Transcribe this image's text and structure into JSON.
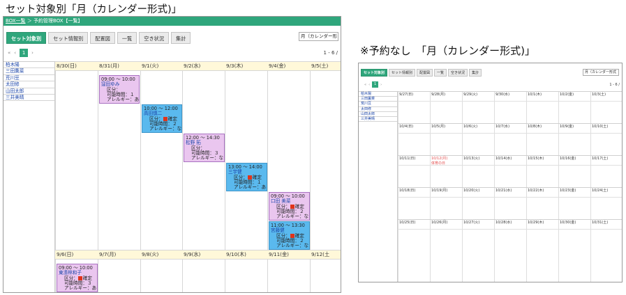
{
  "headings": {
    "main": "セット対象別「月（カレンダー形式)」",
    "no_reservation": "※予約なし　「月（カレンダー形式)」"
  },
  "panel1": {
    "topbar": {
      "crumb": "BOX一覧",
      "sep": " ＞ ",
      "title": "予約管理BOX【一覧】"
    },
    "tabs": [
      "セット対象別",
      "セット情報別",
      "配置図",
      "一覧",
      "空き状況",
      "集計"
    ],
    "view_select": "月（カレンダー形",
    "pager": {
      "first": "«",
      "prev": "‹",
      "current": "1",
      "next": "›"
    },
    "count": "1 - 6 /",
    "names": [
      "柏木陽",
      "三田薫菜",
      "荒川豆",
      "太田修",
      "山田太郎",
      "三井美晴"
    ],
    "week1": [
      "8/30(日)",
      "8/31(月)",
      "9/1(火)",
      "9/2(水)",
      "9/3(木)",
      "9/4(金)",
      "9/5(土)"
    ],
    "week2": [
      "9/6(日)",
      "9/7(月)",
      "9/8(火)",
      "9/9(水)",
      "9/10(木)",
      "9/11(金)",
      "9/12(土"
    ],
    "events": [
      {
        "time": "09:00 ～ 10:00",
        "name": "窪田ゆみ",
        "kubun": "区分：",
        "status": "",
        "kanou": "可能時間：１",
        "allergy": "アレルギー：あり",
        "color": "pink"
      },
      {
        "time": "10:00 ～ 12:00",
        "name": "高田慎二",
        "kubun": "区分：",
        "status": "確定",
        "kanou": "可能時間：２",
        "allergy": "アレルギー：なし",
        "color": "blue"
      },
      {
        "time": "12:00 ～ 14:30",
        "name": "松野 拓",
        "kubun": "区分：",
        "status": "",
        "kanou": "可能時間：３",
        "allergy": "アレルギー：なし",
        "color": "pink"
      },
      {
        "time": "13:00 ～ 14:00",
        "name": "三宇健",
        "kubun": "区分：",
        "status": "確定",
        "kanou": "可能時間：１",
        "allergy": "アレルギー：あり",
        "color": "blue"
      },
      {
        "time": "09:00 ～ 10:00",
        "name": "口田 美菜",
        "kubun": "区分：",
        "status": "確定",
        "kanou": "可能時間：２",
        "allergy": "アレルギー：なし",
        "color": "pink"
      },
      {
        "time": "11:00 ～ 13:30",
        "name": "宮藤健",
        "kubun": "区分：",
        "status": "確定",
        "kanou": "可能時間：２",
        "allergy": "アレルギー：なし",
        "color": "blue"
      },
      {
        "time": "09:00 ～ 10:00",
        "name": "東湊林和子",
        "kubun": "区分：",
        "status": "確定",
        "kanou": "可能時間：３",
        "allergy": "アレルギー：あり",
        "color": "pink"
      }
    ]
  },
  "panel2": {
    "tabs": [
      "セット対象別",
      "セット情報別",
      "配置図",
      "一覧",
      "空き状況",
      "集計"
    ],
    "view_select": "月（カレンダー形式",
    "pager": {
      "first": "«",
      "prev": "‹",
      "current": "1",
      "next": "›"
    },
    "count": "1 - 6 /",
    "names": [
      "柏木陽",
      "三田薫菜",
      "荒川豆",
      "太田修",
      "山田太郎",
      "三井美晴"
    ],
    "weeks": [
      [
        "9/27(日)",
        "9/28(月)",
        "9/29(火)",
        "9/30(水)",
        "10/1(木)",
        "10/2(金)",
        "10/3(土)"
      ],
      [
        "10/4(日)",
        "10/5(月)",
        "10/6(火)",
        "10/7(水)",
        "10/8(木)",
        "10/9(金)",
        "10/10(土)"
      ],
      [
        "10/11(日)",
        "10/12(月)",
        "10/13(火)",
        "10/14(水)",
        "10/15(木)",
        "10/16(金)",
        "10/17(土)"
      ],
      [
        "10/18(日)",
        "10/19(月)",
        "10/20(火)",
        "10/21(水)",
        "10/22(木)",
        "10/23(金)",
        "10/24(土)"
      ],
      [
        "10/25(日)",
        "10/26(月)",
        "10/27(火)",
        "10/28(水)",
        "10/29(木)",
        "10/30(金)",
        "10/31(土)"
      ]
    ],
    "holiday_label": "体育の日"
  }
}
